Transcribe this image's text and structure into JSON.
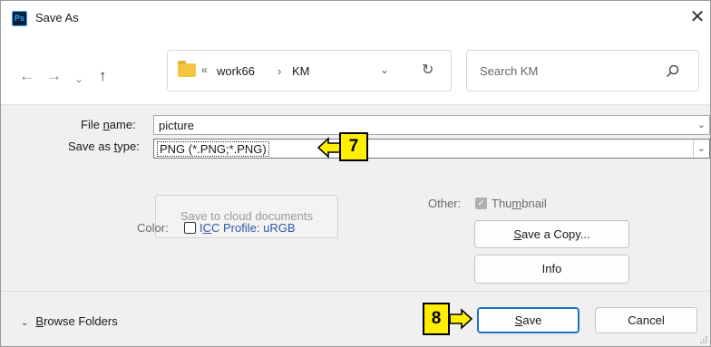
{
  "window": {
    "app_icon_label": "Ps",
    "title": "Save As",
    "close_label": "✕"
  },
  "nav": {
    "back": "←",
    "forward": "→",
    "recent": "⌄",
    "up": "↑",
    "address": {
      "overflow": "«",
      "crumb_1": "work66",
      "separator": "›",
      "crumb_2": "KM",
      "dropdown": "⌄",
      "refresh": "↻"
    },
    "search_placeholder": "Search KM"
  },
  "form": {
    "file_name_label_pre": "File ",
    "file_name_label_u": "n",
    "file_name_label_post": "ame:",
    "file_name_value": "picture",
    "save_type_label_pre": "Save as ",
    "save_type_label_u": "t",
    "save_type_label_post": "ype:",
    "save_type_value": "PNG (*.PNG;*.PNG)",
    "dropdown_chevron": "⌄"
  },
  "options": {
    "cloud_button": "Save to cloud documents",
    "color_label": "Color:",
    "icc_pre": "I",
    "icc_u": "C",
    "icc_post": "C Profile:  uRGB",
    "icc_checked": false,
    "other_label": "Other:",
    "thumbnail_pre": "Thu",
    "thumbnail_u": "m",
    "thumbnail_post": "bnail",
    "thumbnail_checked": true,
    "save_copy_pre": "",
    "save_copy_u": "S",
    "save_copy_post": "ave a Copy...",
    "info_button": "Info"
  },
  "footer": {
    "browse_chevron": "⌄",
    "browse_u": "B",
    "browse_post": "rowse Folders",
    "save_u": "S",
    "save_post": "ave",
    "cancel_button": "Cancel"
  },
  "annotations": {
    "step_7": "7",
    "step_8": "8",
    "highlight_color": "#ffee00"
  },
  "colors": {
    "accent": "#1a73c8",
    "ps_icon_bg": "#0a1f3c",
    "ps_icon_fg": "#31a8ff",
    "folder": "#f5c542"
  }
}
